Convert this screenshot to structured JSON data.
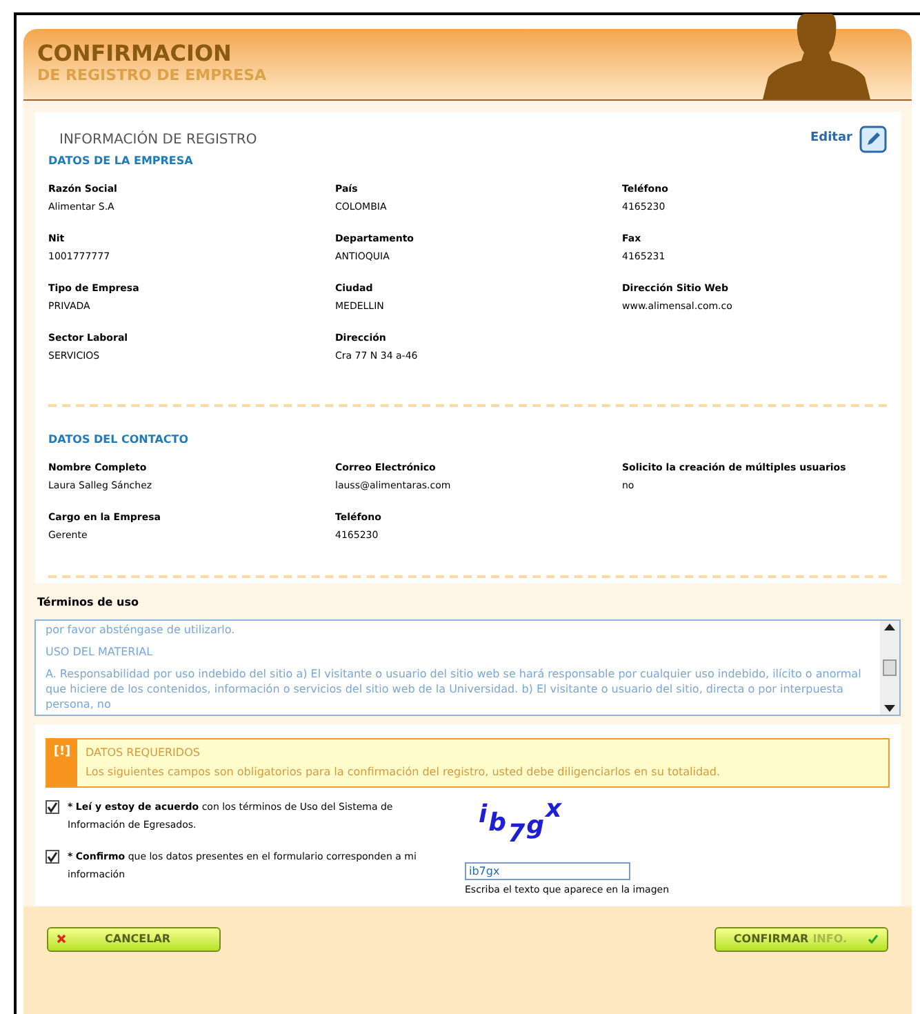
{
  "header": {
    "title": "CONFIRMACION",
    "subtitle": "DE REGISTRO DE EMPRESA"
  },
  "registro": {
    "title": "INFORMACIÓN DE REGISTRO",
    "edit_label": "Editar",
    "sections": [
      {
        "title": "DATOS DE LA EMPRESA",
        "fields": [
          {
            "label": "Razón Social",
            "value": "Alimentar S.A"
          },
          {
            "label": "País",
            "value": "COLOMBIA"
          },
          {
            "label": "Teléfono",
            "value": "4165230"
          },
          {
            "label": "Nit",
            "value": "1001777777"
          },
          {
            "label": "Departamento",
            "value": "ANTIOQUIA"
          },
          {
            "label": "Fax",
            "value": "4165231"
          },
          {
            "label": "Tipo de Empresa",
            "value": "PRIVADA"
          },
          {
            "label": "Ciudad",
            "value": "MEDELLIN"
          },
          {
            "label": "Dirección Sitio Web",
            "value": "www.alimensal.com.co"
          },
          {
            "label": "Sector Laboral",
            "value": "SERVICIOS"
          },
          {
            "label": "Dirección",
            "value": "Cra 77 N 34 a-46"
          }
        ]
      },
      {
        "title": "DATOS DEL CONTACTO",
        "fields": [
          {
            "label": "Nombre Completo",
            "value": "Laura Salleg Sánchez"
          },
          {
            "label": "Correo Electrónico",
            "value": "lauss@alimentaras.com"
          },
          {
            "label": "Solicito la creación de múltiples usuarios",
            "value": "no"
          },
          {
            "label": "Cargo en la Empresa",
            "value": "Gerente"
          },
          {
            "label": "Teléfono",
            "value": "4165230"
          }
        ]
      }
    ]
  },
  "terms": {
    "title": "Términos de uso",
    "paragraphs": [
      "por favor absténgase de utilizarlo.",
      "USO DEL MATERIAL",
      "A. Responsabilidad por uso indebido del sitio a) El visitante o usuario del sitio web se hará responsable por cualquier uso indebido, ilícito o anormal que hiciere de los contenidos, información o servicios del sitio web de la Universidad. b) El visitante o usuario del sitio, directa o por interpuesta persona, no"
    ]
  },
  "required": {
    "icon_text": "[!]",
    "title": "DATOS REQUERIDOS",
    "message": "Los siguientes campos son obligatorios para la confirmación del registro, usted debe diligenciarlos en su totalidad."
  },
  "agreements": [
    {
      "marker": "*",
      "text": "**Leí y estoy de acuerdo** con los términos de Uso del Sistema de Información de Egresados.",
      "checked": true
    },
    {
      "marker": "*",
      "text": "**Confirmo** que los datos presentes en el formulario corresponden a mi información",
      "checked": true
    }
  ],
  "captcha": {
    "characters": [
      "i",
      "b",
      "7",
      "g",
      "x"
    ],
    "value": "ib7gx",
    "hint": "Escriba el texto que aparece en la imagen"
  },
  "buttons": {
    "cancel": "CANCELAR",
    "confirm": "CONFIRMAR",
    "confirm_suffix": "INFO."
  }
}
